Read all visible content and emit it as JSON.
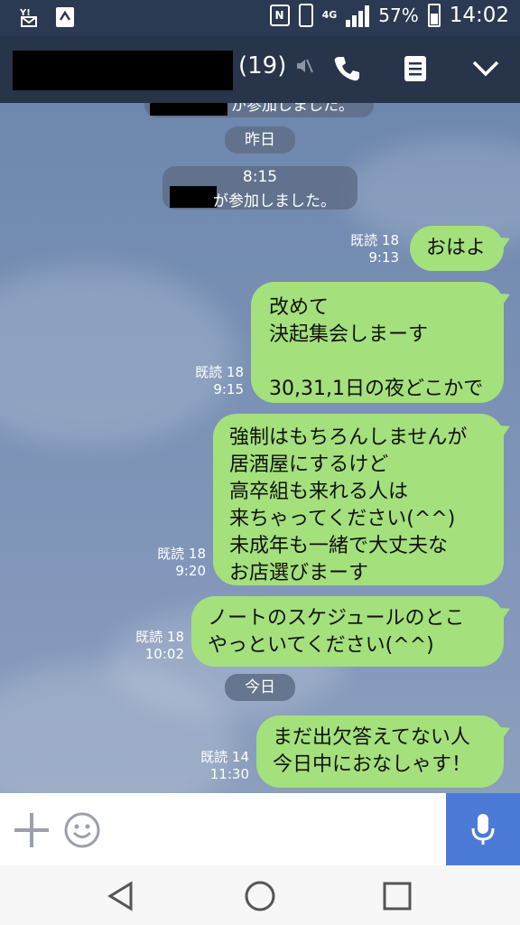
{
  "status_bar": {
    "battery": "57%",
    "time": "14:02",
    "network": "4G",
    "icons": [
      "yahoo-mail-icon",
      "clipboard-icon",
      "nfc-icon",
      "phone-vibrate-icon",
      "signal-icon",
      "battery-icon"
    ]
  },
  "header": {
    "member_count": "(19)",
    "icons": [
      "mute-icon",
      "call-icon",
      "note-icon",
      "chevron-down-icon"
    ]
  },
  "chat": {
    "top_partial_system": "が参加しました。",
    "date_yesterday": "昨日",
    "join_time": "8:15",
    "join_text": "が参加しました。",
    "date_today": "今日",
    "messages": [
      {
        "read": "既読 18",
        "time": "9:13",
        "text": "おはよ"
      },
      {
        "read": "既読 18",
        "time": "9:15",
        "text": "改めて\n決起集会しまーす\n\n30,31,1日の夜どこかで"
      },
      {
        "read": "既読 18",
        "time": "9:20",
        "text": "強制はもちろんしませんが\n居酒屋にするけど\n高卒組も来れる人は\n来ちゃってください(^^)\n未成年も一緒で大丈夫な\nお店選びまーす"
      },
      {
        "read": "既読 18",
        "time": "10:02",
        "text": "ノートのスケジュールのとこ\nやっといてください(^^)"
      },
      {
        "read": "既読 14",
        "time": "11:30",
        "text": "まだ出欠答えてない人\n今日中におなしゃす！"
      }
    ]
  },
  "input": {
    "placeholder": "",
    "icons": [
      "plus-icon",
      "emoji-icon",
      "microphone-icon"
    ]
  },
  "nav": {
    "icons": [
      "back-icon",
      "home-icon",
      "recents-icon"
    ]
  },
  "colors": {
    "bubble": "#a4e07c",
    "header": "#273449",
    "mic": "#4b7bd6"
  }
}
